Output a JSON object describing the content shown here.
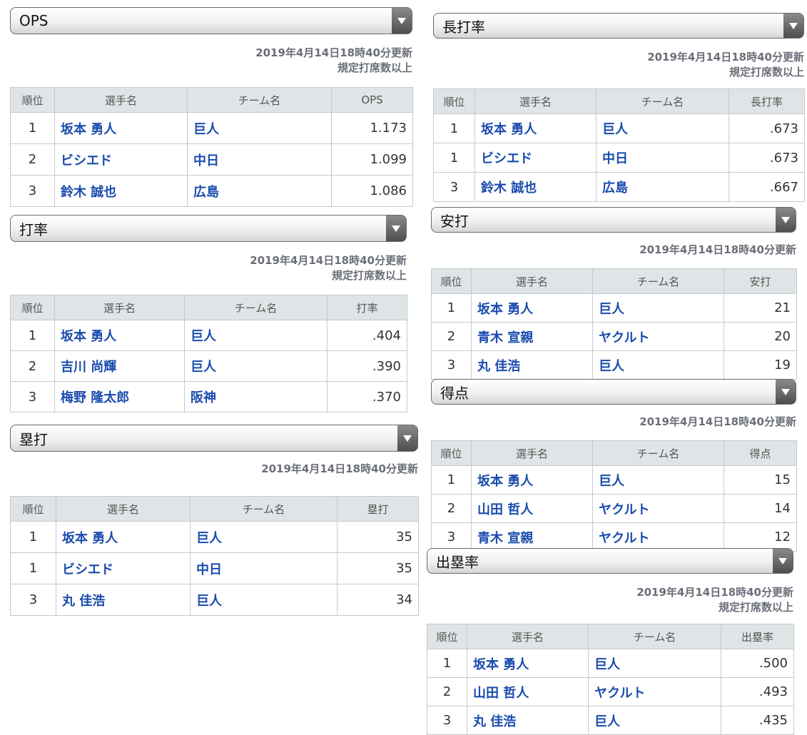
{
  "arrow_icon": "chevron-down-icon",
  "colors": {
    "link": "#1a4cae",
    "header_bg": "#dfe5e6",
    "meta_text": "#6a6e78"
  },
  "panels": [
    {
      "key": "ops",
      "title": "OPS",
      "updated": "2019年4月14日18時40分更新",
      "qualifier": "規定打席数以上",
      "headers": [
        "順位",
        "選手名",
        "チーム名",
        "OPS"
      ],
      "rows": [
        {
          "rank": "1",
          "player": "坂本 勇人",
          "team": "巨人",
          "value": "1.173"
        },
        {
          "rank": "2",
          "player": "ビシエド",
          "team": "中日",
          "value": "1.099"
        },
        {
          "rank": "3",
          "player": "鈴木 誠也",
          "team": "広島",
          "value": "1.086"
        }
      ]
    },
    {
      "key": "avg",
      "title": "打率",
      "updated": "2019年4月14日18時40分更新",
      "qualifier": "規定打席数以上",
      "headers": [
        "順位",
        "選手名",
        "チーム名",
        "打率"
      ],
      "rows": [
        {
          "rank": "1",
          "player": "坂本 勇人",
          "team": "巨人",
          "value": ".404"
        },
        {
          "rank": "2",
          "player": "吉川 尚輝",
          "team": "巨人",
          "value": ".390"
        },
        {
          "rank": "3",
          "player": "梅野 隆太郎",
          "team": "阪神",
          "value": ".370"
        }
      ]
    },
    {
      "key": "hr",
      "title": "塁打",
      "updated": "2019年4月14日18時40分更新",
      "qualifier": "",
      "headers": [
        "順位",
        "選手名",
        "チーム名",
        "塁打"
      ],
      "rows": [
        {
          "rank": "1",
          "player": "坂本 勇人",
          "team": "巨人",
          "value": "35"
        },
        {
          "rank": "1",
          "player": "ビシエド",
          "team": "中日",
          "value": "35"
        },
        {
          "rank": "3",
          "player": "丸 佳浩",
          "team": "巨人",
          "value": "34"
        }
      ]
    },
    {
      "key": "slg",
      "title": "長打率",
      "updated": "2019年4月14日18時40分更新",
      "qualifier": "規定打席数以上",
      "headers": [
        "順位",
        "選手名",
        "チーム名",
        "長打率"
      ],
      "rows": [
        {
          "rank": "1",
          "player": "坂本 勇人",
          "team": "巨人",
          "value": ".673"
        },
        {
          "rank": "1",
          "player": "ビシエド",
          "team": "中日",
          "value": ".673"
        },
        {
          "rank": "3",
          "player": "鈴木 誠也",
          "team": "広島",
          "value": ".667"
        }
      ]
    },
    {
      "key": "hits",
      "title": "安打",
      "updated": "2019年4月14日18時40分更新",
      "qualifier": "",
      "headers": [
        "順位",
        "選手名",
        "チーム名",
        "安打"
      ],
      "rows": [
        {
          "rank": "1",
          "player": "坂本 勇人",
          "team": "巨人",
          "value": "21"
        },
        {
          "rank": "2",
          "player": "青木 宣親",
          "team": "ヤクルト",
          "value": "20"
        },
        {
          "rank": "3",
          "player": "丸 佳浩",
          "team": "巨人",
          "value": "19"
        }
      ]
    },
    {
      "key": "runs",
      "title": "得点",
      "updated": "2019年4月14日18時40分更新",
      "qualifier": "",
      "headers": [
        "順位",
        "選手名",
        "チーム名",
        "得点"
      ],
      "rows": [
        {
          "rank": "1",
          "player": "坂本 勇人",
          "team": "巨人",
          "value": "15"
        },
        {
          "rank": "2",
          "player": "山田 哲人",
          "team": "ヤクルト",
          "value": "14"
        },
        {
          "rank": "3",
          "player": "青木 宣親",
          "team": "ヤクルト",
          "value": "12"
        }
      ]
    },
    {
      "key": "obp",
      "title": "出塁率",
      "updated": "2019年4月14日18時40分更新",
      "qualifier": "規定打席数以上",
      "headers": [
        "順位",
        "選手名",
        "チーム名",
        "出塁率"
      ],
      "rows": [
        {
          "rank": "1",
          "player": "坂本 勇人",
          "team": "巨人",
          "value": ".500"
        },
        {
          "rank": "2",
          "player": "山田 哲人",
          "team": "ヤクルト",
          "value": ".493"
        },
        {
          "rank": "3",
          "player": "丸 佳浩",
          "team": "巨人",
          "value": ".435"
        }
      ]
    }
  ]
}
